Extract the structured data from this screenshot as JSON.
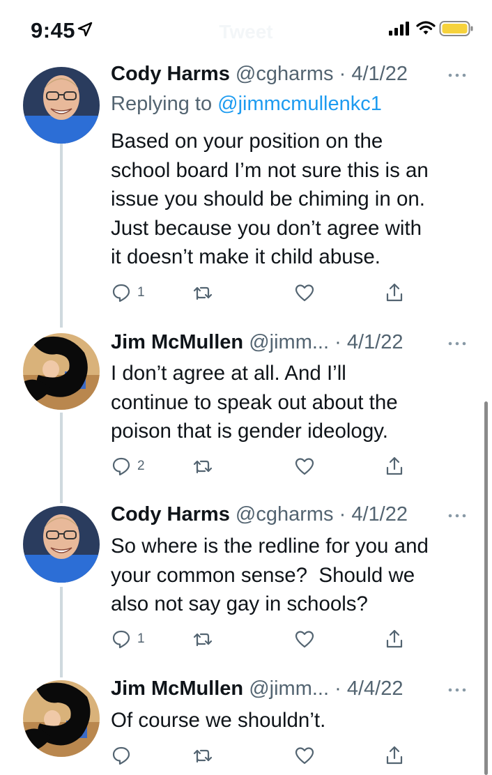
{
  "status_bar": {
    "time": "9:45",
    "ghost_title": "Tweet",
    "icons": [
      "location-arrow-icon",
      "cellular-signal-icon",
      "wifi-icon",
      "battery-icon"
    ],
    "battery_color": "#f6d23c"
  },
  "colors": {
    "text": "#0f1419",
    "secondary": "#536471",
    "link": "#1d9bf0",
    "thread_line": "#cfd9de"
  },
  "tweets": [
    {
      "name": "Cody Harms",
      "handle": "@cgharms",
      "separator": "·",
      "date": "4/1/22",
      "replying_prefix": "Replying to ",
      "replying_to": "@jimmcmullenkc1",
      "lines": [
        "Based on your position on the",
        "school board I’m not sure this is an",
        "issue you should be chiming in on.",
        "Just because you don’t agree with",
        "it doesn’t make it child abuse."
      ],
      "reply_count": "1",
      "avatar": "avatar-cody"
    },
    {
      "name": "Jim McMullen",
      "handle": "@jimm...",
      "separator": "·",
      "date": "4/1/22",
      "lines": [
        "I don’t agree at all. And I’ll",
        "continue to speak out about the",
        "poison that is gender ideology."
      ],
      "reply_count": "2",
      "avatar": "avatar-jim-redacted"
    },
    {
      "name": "Cody Harms",
      "handle": "@cgharms",
      "separator": "·",
      "date": "4/1/22",
      "lines": [
        "So where is the redline for you and",
        "your common sense?  Should we",
        "also not say gay in schools?"
      ],
      "reply_count": "1",
      "avatar": "avatar-cody"
    },
    {
      "name": "Jim McMullen",
      "handle": "@jimm...",
      "separator": "·",
      "date": "4/4/22",
      "lines": [
        "Of course we shouldn’t."
      ],
      "reply_count": "",
      "avatar": "avatar-jim-redacted"
    }
  ]
}
